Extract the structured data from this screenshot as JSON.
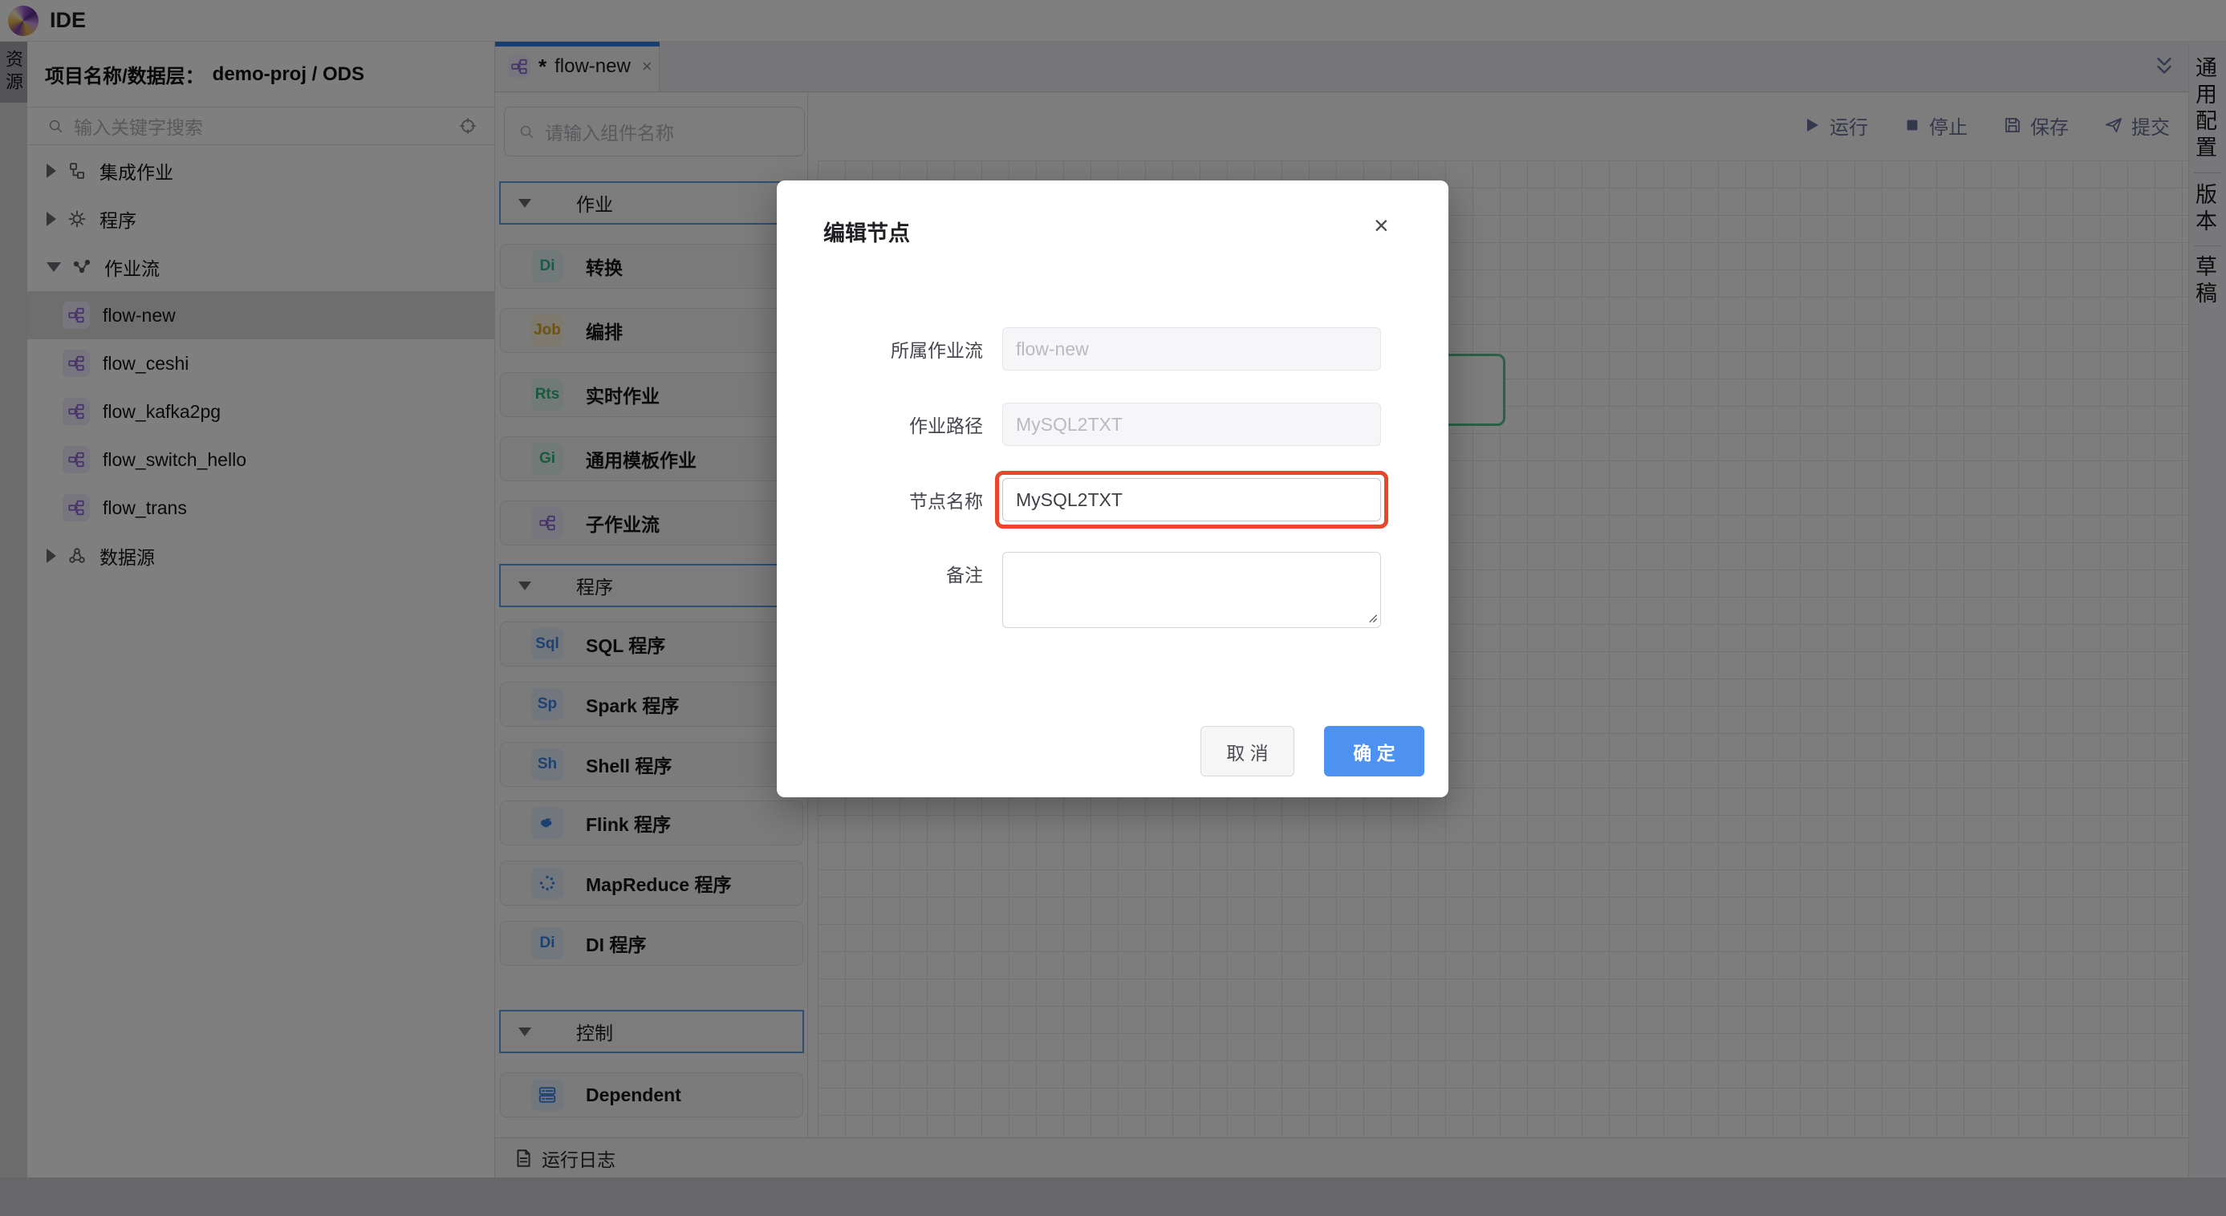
{
  "app": {
    "title": "IDE"
  },
  "activity_bar": {
    "resources_tab": "资源"
  },
  "explorer": {
    "header_label": "项目名称/数据层：",
    "header_value": "demo-proj / ODS",
    "search_placeholder": "输入关键字搜索",
    "tree": [
      {
        "label": "集成作业"
      },
      {
        "label": "程序"
      },
      {
        "label": "作业流"
      },
      {
        "label": "flow-new"
      },
      {
        "label": "flow_ceshi"
      },
      {
        "label": "flow_kafka2pg"
      },
      {
        "label": "flow_switch_hello"
      },
      {
        "label": "flow_trans"
      },
      {
        "label": "数据源"
      }
    ]
  },
  "editor": {
    "tab": {
      "modified_marker": "*",
      "label": "flow-new",
      "close": "×"
    },
    "palette": {
      "search_placeholder": "请输入组件名称",
      "groups": [
        {
          "label": "作业",
          "items": [
            {
              "badge": "Di",
              "label": "转换"
            },
            {
              "badge": "Job",
              "label": "编排"
            },
            {
              "badge": "Rts",
              "label": "实时作业"
            },
            {
              "badge": "Gi",
              "label": "通用模板作业"
            },
            {
              "badge": "",
              "label": "子作业流"
            }
          ]
        },
        {
          "label": "程序",
          "items": [
            {
              "badge": "Sql",
              "label": "SQL 程序"
            },
            {
              "badge": "Sp",
              "label": "Spark 程序"
            },
            {
              "badge": "Sh",
              "label": "Shell 程序"
            },
            {
              "badge": "",
              "label": "Flink 程序"
            },
            {
              "badge": "",
              "label": "MapReduce 程序"
            },
            {
              "badge": "Di",
              "label": "DI 程序"
            }
          ]
        },
        {
          "label": "控制",
          "items": [
            {
              "badge": "",
              "label": "Dependent"
            }
          ]
        }
      ]
    },
    "log_bar": "运行日志"
  },
  "canvas_toolbar": {
    "run": "运行",
    "stop": "停止",
    "save": "保存",
    "submit": "提交"
  },
  "right_bar": {
    "tabs": [
      "通用配置",
      "版本",
      "草稿"
    ]
  },
  "dialog": {
    "title": "编辑节点",
    "close": "×",
    "fields": [
      {
        "label": "所属作业流",
        "value": "flow-new"
      },
      {
        "label": "作业路径",
        "value": "MySQL2TXT"
      },
      {
        "label": "节点名称",
        "value": "MySQL2TXT"
      },
      {
        "label": "备注",
        "value": ""
      }
    ],
    "cancel_label": "取 消",
    "ok_label": "确 定"
  },
  "colors": {
    "accent_blue": "#2f80d9",
    "group_border_blue": "#5c9de8",
    "ok_button_blue": "#4d92f0",
    "highlight_ring_red": "#e8472b",
    "node_border_green": "#52c08e",
    "overlay": "rgba(0,0,0,0.5)"
  }
}
